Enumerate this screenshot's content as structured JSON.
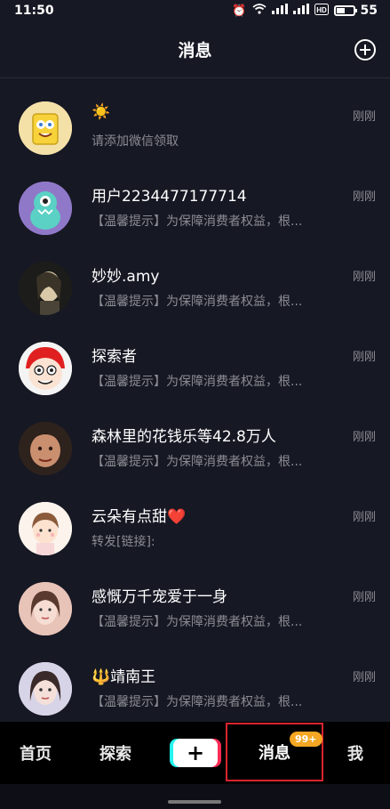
{
  "status_bar": {
    "time": "11:50",
    "battery_level": "55",
    "battery_percent": 55
  },
  "header": {
    "title": "消息"
  },
  "messages": [
    {
      "name": "☀️",
      "preview": "请添加微信领取",
      "time": "刚刚"
    },
    {
      "name": "用户2234477177714",
      "preview": "【温馨提示】为保障消费者权益，根...",
      "time": "刚刚"
    },
    {
      "name": "妙妙.amy",
      "preview": "【温馨提示】为保障消费者权益，根...",
      "time": "刚刚"
    },
    {
      "name": "探索者",
      "preview": "【温馨提示】为保障消费者权益，根...",
      "time": "刚刚"
    },
    {
      "name": "森林里的花钱乐等42.8万人",
      "preview": "【温馨提示】为保障消费者权益，根...",
      "time": "刚刚"
    },
    {
      "name": "云朵有点甜",
      "name_emoji": "❤️",
      "preview": "转发[链接]:",
      "time": "刚刚"
    },
    {
      "name": "感慨万千宠爱于一身",
      "preview": "【温馨提示】为保障消费者权益，根...",
      "time": "刚刚"
    },
    {
      "name": "🔱靖南王",
      "preview": "【温馨提示】为保障消费者权益，根...",
      "time": "刚刚"
    }
  ],
  "tabbar": {
    "home": "首页",
    "explore": "探索",
    "create": "+",
    "messages": "消息",
    "messages_badge": "99+",
    "me": "我"
  }
}
